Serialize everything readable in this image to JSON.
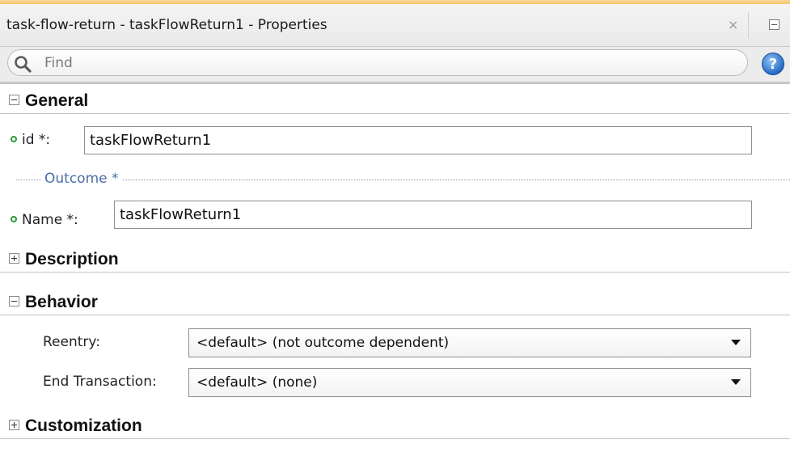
{
  "window": {
    "title": "task-flow-return - taskFlowReturn1 - Properties",
    "close_glyph": "×"
  },
  "search": {
    "placeholder": "Find",
    "value": ""
  },
  "sections": {
    "general": {
      "title": "General",
      "expanded": true,
      "id_label": "id *:",
      "id_value": "taskFlowReturn1",
      "outcome_group_label": "Outcome *",
      "name_label": "Name *:",
      "name_value": "taskFlowReturn1"
    },
    "description": {
      "title": "Description",
      "expanded": false
    },
    "behavior": {
      "title": "Behavior",
      "expanded": true,
      "reentry_label": "Reentry:",
      "reentry_value": "<default> (not outcome dependent)",
      "end_transaction_label": "End Transaction:",
      "end_transaction_value": "<default> (none)"
    },
    "customization": {
      "title": "Customization",
      "expanded": false
    }
  },
  "colors": {
    "accent_top": "#f6c36b",
    "required_indicator": "#2e9b39",
    "group_label": "#4a6fa5",
    "help_icon": "#2f7ad3"
  },
  "icons": [
    "search-icon",
    "help-icon",
    "close-icon",
    "minimize-icon",
    "collapse-icon",
    "expand-icon",
    "chevron-down-icon"
  ]
}
